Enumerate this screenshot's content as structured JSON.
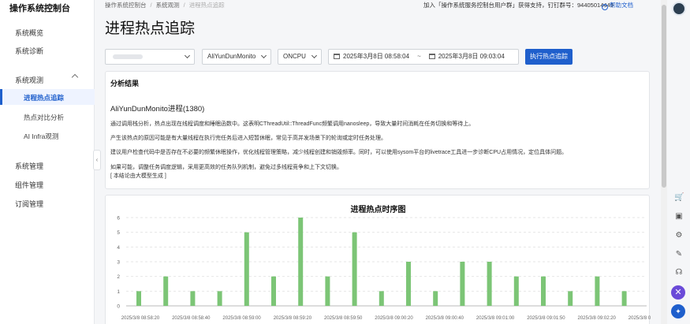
{
  "app": {
    "title": "操作系统控制台"
  },
  "sidebar": {
    "items": [
      {
        "label": "系统概览"
      },
      {
        "label": "系统诊断"
      },
      {
        "label": "系统观测"
      },
      {
        "label": "系统管理"
      },
      {
        "label": "组件管理"
      },
      {
        "label": "订阅管理"
      }
    ],
    "sub_items": [
      {
        "label": "进程热点追踪",
        "active": true
      },
      {
        "label": "热点对比分析"
      },
      {
        "label": "AI Infra观测"
      }
    ]
  },
  "breadcrumb": [
    "操作系统控制台",
    "系统观测",
    "进程热点追踪"
  ],
  "header": {
    "join_text": "加入「操作系统服务控制台用户群」获得支持，钉钉群号：94405014449",
    "help_label": "帮助文档"
  },
  "page": {
    "title": "进程热点追踪"
  },
  "filters": {
    "instance_value": "",
    "process_value": "AliYunDunMonito",
    "type_value": "ONCPU",
    "start_time": "2025年3月8日 08:58:04",
    "end_time": "2025年3月8日 09:03:04",
    "run_button": "执行热点追踪"
  },
  "result": {
    "title": "分析结果",
    "process": "AliYunDunMonito进程(1380)",
    "paragraphs": [
      "通过调用栈分析，热点出现在线程调度和睡眠函数中。这表明CThreadUtil::ThreadFunc频繁调用nanosleep，导致大量时间消耗在任务切换和等待上。",
      "产生该热点的原因可能是有大量线程在执行完任务后进入短暂休眠，常见于高并发场景下的轮询或定时任务处理。",
      "建议用户检查代码中是否存在不必要的频繁休眠操作，优化线程管理策略，减少线程创建和销毁频率。同时，可以使用sysom平台的livetrace工具进一步诊断CPU占用情况，定位具体问题。",
      "如果可能，调整任务调度逻辑，采用更高效的任务队列机制，避免过多线程竞争和上下文切换。",
      "[ 本结论由大模型生成 ]"
    ]
  },
  "chart_data": {
    "type": "bar",
    "title": "进程热点时序图",
    "xlabel": "",
    "ylabel": "",
    "ylim": [
      0,
      6
    ],
    "yticks": [
      "0",
      "1",
      "2",
      "3",
      "4",
      "5",
      "6"
    ],
    "tick_labels": [
      "2025/3/8 08:58:20",
      "2025/3/8 08:58:40",
      "2025/3/8 08:59:00",
      "2025/3/8 08:59:20",
      "2025/3/8 08:59:50",
      "2025/3/8 09:00:20",
      "2025/3/8 09:00:40",
      "2025/3/8 09:01:00",
      "2025/3/8 09:01:50",
      "2025/3/8 09:02:20",
      "2025/3/8 09:02:50"
    ],
    "values": [
      1,
      2,
      1,
      1,
      5,
      2,
      6,
      2,
      5,
      1,
      3,
      1,
      3,
      3,
      2,
      2,
      1,
      2,
      1
    ],
    "color": "#7cc576",
    "grid": true
  },
  "icons": [
    "avatar",
    "cart-icon",
    "document-icon",
    "settings-icon",
    "edit-icon",
    "headset-icon",
    "close-icon",
    "ai-icon"
  ]
}
